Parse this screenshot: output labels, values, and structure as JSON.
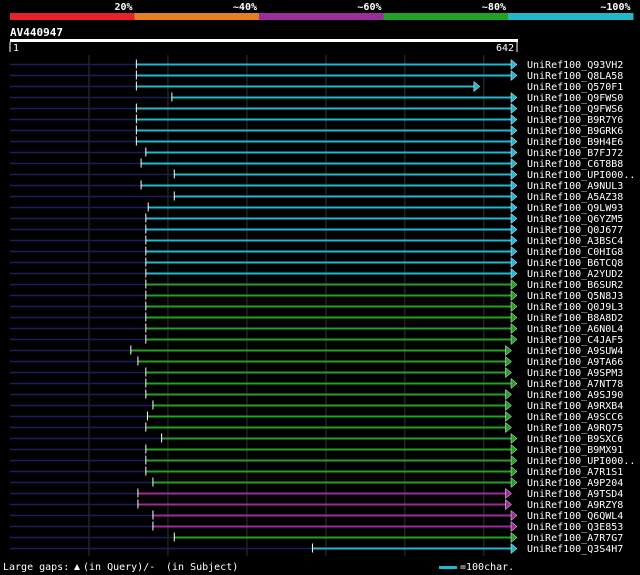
{
  "legend": {
    "segments": [
      {
        "label": "20%",
        "color": "#e8202a"
      },
      {
        "label": "~40%",
        "color": "#e67e22"
      },
      {
        "label": "~60%",
        "color": "#9b2d9b"
      },
      {
        "label": "~80%",
        "color": "#22a122"
      },
      {
        "label": "~100%",
        "color": "#22b8c8"
      }
    ]
  },
  "query": {
    "name": "AV440947",
    "start": "1",
    "end": "642",
    "length": 642
  },
  "hits": [
    {
      "name": "UniRef100_Q93VH2",
      "start": 160,
      "end": 642,
      "color": "cyan"
    },
    {
      "name": "UniRef100_Q8LA58",
      "start": 160,
      "end": 642,
      "color": "cyan"
    },
    {
      "name": "UniRef100_Q570F1",
      "start": 160,
      "end": 595,
      "color": "cyan"
    },
    {
      "name": "UniRef100_Q9FWS0",
      "start": 205,
      "end": 642,
      "color": "cyan"
    },
    {
      "name": "UniRef100_Q9FWS6",
      "start": 160,
      "end": 642,
      "color": "cyan"
    },
    {
      "name": "UniRef100_B9R7Y6",
      "start": 160,
      "end": 642,
      "color": "cyan"
    },
    {
      "name": "UniRef100_B9GRK6",
      "start": 160,
      "end": 642,
      "color": "cyan"
    },
    {
      "name": "UniRef100_B9H4E6",
      "start": 160,
      "end": 642,
      "color": "cyan"
    },
    {
      "name": "UniRef100_B7FJ72",
      "start": 172,
      "end": 642,
      "color": "cyan"
    },
    {
      "name": "UniRef100_C6T8B8",
      "start": 166,
      "end": 642,
      "color": "cyan"
    },
    {
      "name": "UniRef100_UPI000..",
      "start": 208,
      "end": 642,
      "color": "cyan"
    },
    {
      "name": "UniRef100_A9NUL3",
      "start": 166,
      "end": 642,
      "color": "cyan"
    },
    {
      "name": "UniRef100_A5AZ38",
      "start": 208,
      "end": 642,
      "color": "cyan"
    },
    {
      "name": "UniRef100_Q9LW93",
      "start": 175,
      "end": 642,
      "color": "cyan"
    },
    {
      "name": "UniRef100_Q6YZM5",
      "start": 172,
      "end": 642,
      "color": "cyan"
    },
    {
      "name": "UniRef100_Q0J677",
      "start": 172,
      "end": 642,
      "color": "cyan"
    },
    {
      "name": "UniRef100_A3BSC4",
      "start": 172,
      "end": 642,
      "color": "cyan"
    },
    {
      "name": "UniRef100_C0HIG8",
      "start": 172,
      "end": 642,
      "color": "cyan"
    },
    {
      "name": "UniRef100_B6TCQ8",
      "start": 172,
      "end": 642,
      "color": "cyan"
    },
    {
      "name": "UniRef100_A2YUD2",
      "start": 172,
      "end": 642,
      "color": "cyan"
    },
    {
      "name": "UniRef100_B6SUR2",
      "start": 172,
      "end": 642,
      "color": "green"
    },
    {
      "name": "UniRef100_Q5N8J3",
      "start": 172,
      "end": 642,
      "color": "green"
    },
    {
      "name": "UniRef100_Q0J9L3",
      "start": 172,
      "end": 642,
      "color": "green"
    },
    {
      "name": "UniRef100_B8A8D2",
      "start": 172,
      "end": 642,
      "color": "green"
    },
    {
      "name": "UniRef100_A6N0L4",
      "start": 172,
      "end": 642,
      "color": "green"
    },
    {
      "name": "UniRef100_C4JAF5",
      "start": 172,
      "end": 642,
      "color": "green"
    },
    {
      "name": "UniRef100_A9SUW4",
      "start": 153,
      "end": 635,
      "color": "green"
    },
    {
      "name": "UniRef100_A9TA66",
      "start": 162,
      "end": 635,
      "color": "green"
    },
    {
      "name": "UniRef100_A9SPM3",
      "start": 172,
      "end": 635,
      "color": "green"
    },
    {
      "name": "UniRef100_A7NT78",
      "start": 172,
      "end": 642,
      "color": "green"
    },
    {
      "name": "UniRef100_A9SJ90",
      "start": 172,
      "end": 635,
      "color": "green"
    },
    {
      "name": "UniRef100_A9RXB4",
      "start": 181,
      "end": 635,
      "color": "green"
    },
    {
      "name": "UniRef100_A9SCC6",
      "start": 174,
      "end": 635,
      "color": "green"
    },
    {
      "name": "UniRef100_A9RQ75",
      "start": 172,
      "end": 635,
      "color": "green"
    },
    {
      "name": "UniRef100_B9SXC6",
      "start": 192,
      "end": 642,
      "color": "green"
    },
    {
      "name": "UniRef100_B9MX91",
      "start": 172,
      "end": 642,
      "color": "green"
    },
    {
      "name": "UniRef100_UPI000..",
      "start": 172,
      "end": 642,
      "color": "green"
    },
    {
      "name": "UniRef100_A7R1S1",
      "start": 172,
      "end": 642,
      "color": "green"
    },
    {
      "name": "UniRef100_A9P204",
      "start": 181,
      "end": 642,
      "color": "green"
    },
    {
      "name": "UniRef100_A9TSD4",
      "start": 162,
      "end": 635,
      "color": "purple"
    },
    {
      "name": "UniRef100_A9RZY8",
      "start": 162,
      "end": 635,
      "color": "purple"
    },
    {
      "name": "UniRef100_Q6QWL4",
      "start": 181,
      "end": 642,
      "color": "purple"
    },
    {
      "name": "UniRef100_Q3E853",
      "start": 181,
      "end": 642,
      "color": "purple"
    },
    {
      "name": "UniRef100_A7R7G7",
      "start": 208,
      "end": 642,
      "color": "green"
    },
    {
      "name": "UniRef100_Q3S4H7",
      "start": 383,
      "end": 642,
      "color": "cyan"
    }
  ],
  "colors": {
    "cyan": "#1fb8d0",
    "green": "#22a122",
    "purple": "#9b2d9b",
    "navy": "#1a1f5c",
    "grid": "#333333"
  },
  "footer": {
    "gaps_label": "Large gaps:",
    "query_gap": "(in Query)/-",
    "subject_gap": "(in Subject)",
    "scale_label": "=100char."
  }
}
